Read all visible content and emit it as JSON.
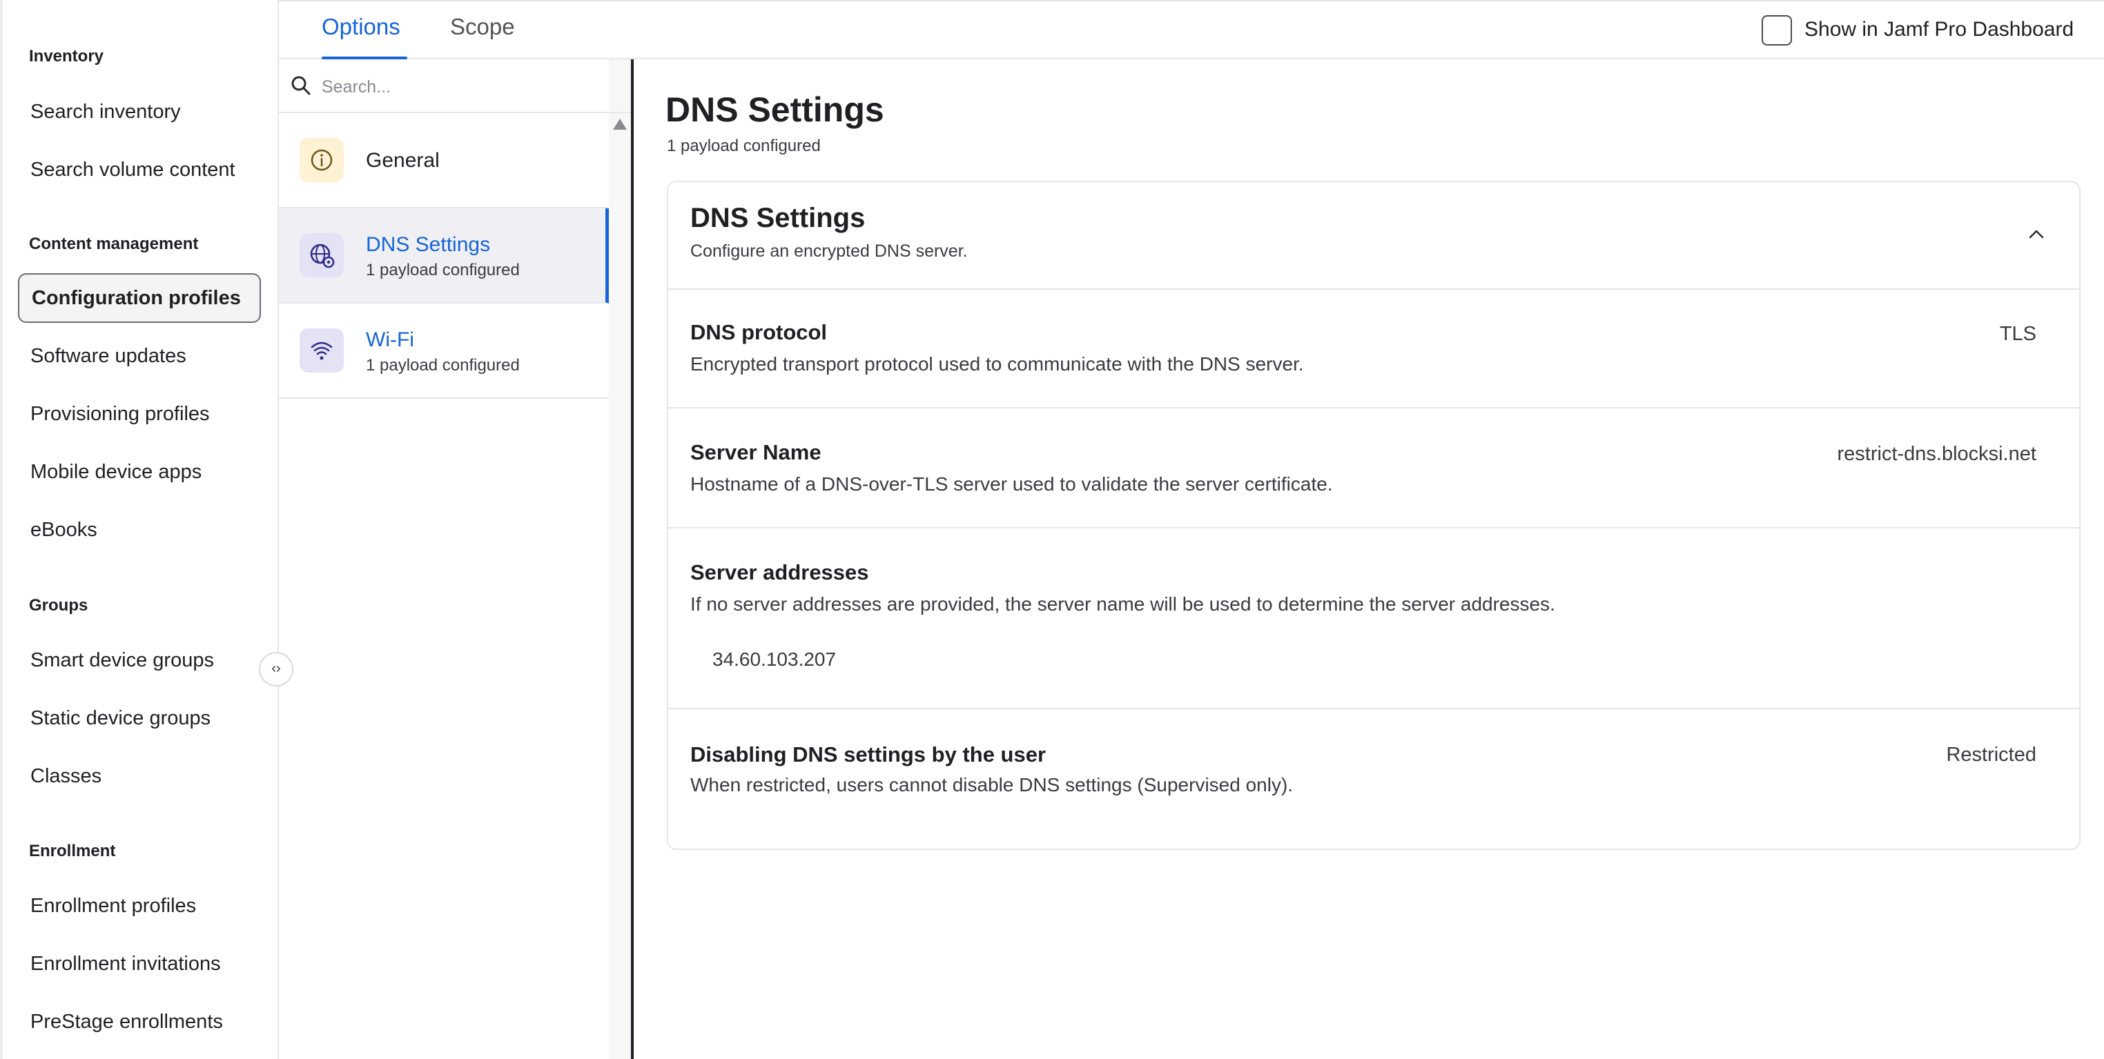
{
  "left_nav": {
    "sections": [
      {
        "heading": "Inventory",
        "items": [
          "Search inventory",
          "Search volume content"
        ]
      },
      {
        "heading": "Content management",
        "items": [
          "Configuration profiles",
          "Software updates",
          "Provisioning profiles",
          "Mobile device apps",
          "eBooks"
        ]
      },
      {
        "heading": "Groups",
        "items": [
          "Smart device groups",
          "Static device groups",
          "Classes"
        ]
      },
      {
        "heading": "Enrollment",
        "items": [
          "Enrollment profiles",
          "Enrollment invitations",
          "PreStage enrollments"
        ]
      }
    ],
    "active_item": "Configuration profiles",
    "collapse_glyph": "‹›"
  },
  "tabs": {
    "items": [
      "Options",
      "Scope"
    ],
    "active": "Options"
  },
  "dashboard_toggle": {
    "label": "Show in Jamf Pro Dashboard",
    "checked": false
  },
  "payload_list": {
    "search_placeholder": "Search...",
    "items": [
      {
        "name": "General",
        "subtitle": "",
        "icon": "info-icon",
        "icon_bg": "#fdf3d4",
        "name_color": "#1f1f24"
      },
      {
        "name": "DNS Settings",
        "subtitle": "1 payload configured",
        "icon": "globe-gear-icon",
        "icon_bg": "#e4e2f4",
        "name_color": "#1565d8"
      },
      {
        "name": "Wi-Fi",
        "subtitle": "1 payload configured",
        "icon": "wifi-icon",
        "icon_bg": "#e4e2f4",
        "name_color": "#1565d8"
      }
    ],
    "selected": "DNS Settings"
  },
  "detail": {
    "title": "DNS Settings",
    "subtitle": "1 payload configured",
    "card": {
      "title": "DNS Settings",
      "description": "Configure an encrypted DNS server.",
      "settings": [
        {
          "label": "DNS protocol",
          "description": "Encrypted transport protocol used to communicate with the DNS server.",
          "value": "TLS"
        },
        {
          "label": "Server Name",
          "description": "Hostname of a DNS-over-TLS server used to validate the server certificate.",
          "value": "restrict-dns.blocksi.net"
        },
        {
          "label": "Server addresses",
          "description": "If no server addresses are provided, the server name will be used to determine the server addresses.",
          "value": "",
          "addresses": [
            "34.60.103.207"
          ]
        },
        {
          "label": "Disabling DNS settings by the user",
          "description": "When restricted, users cannot disable DNS settings (Supervised only).",
          "value": "Restricted"
        }
      ]
    }
  },
  "colors": {
    "accent": "#1565d8",
    "text": "#1f1f24",
    "muted": "#3a3a40",
    "border": "#e6e6ea"
  }
}
